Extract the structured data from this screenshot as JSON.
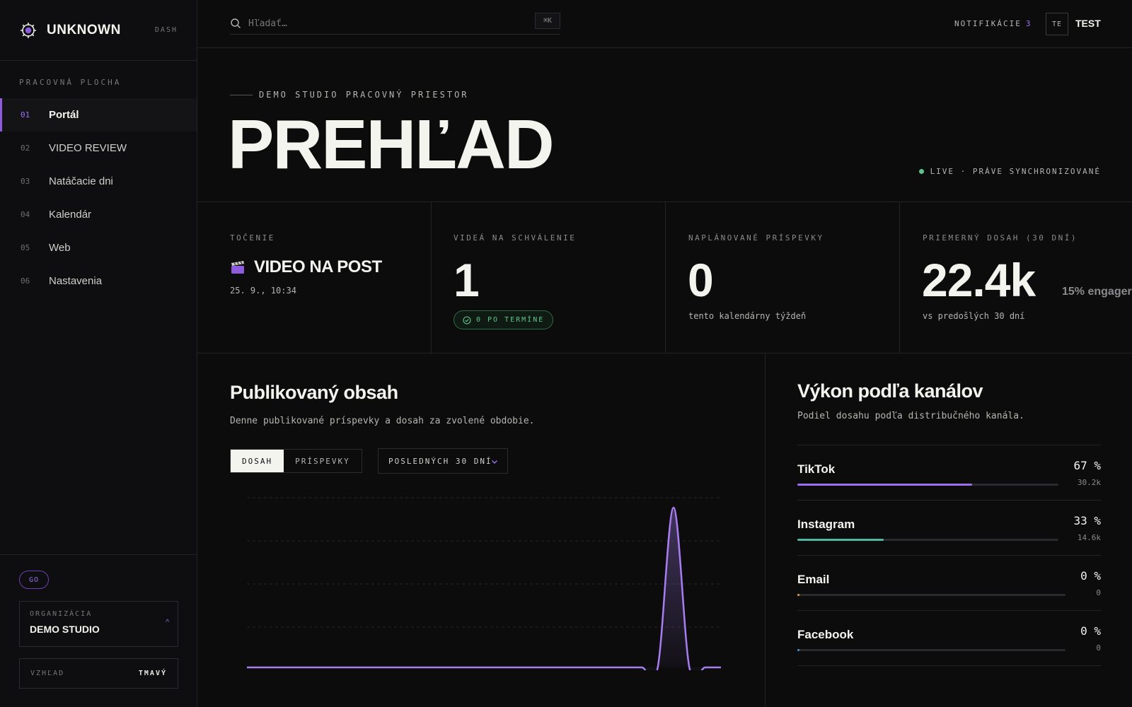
{
  "brand": {
    "name": "UNKNOWN",
    "tag": "DASH"
  },
  "sidebar": {
    "section_label": "PRACOVNÁ PLOCHA",
    "items": [
      {
        "num": "01",
        "label": "Portál",
        "active": true
      },
      {
        "num": "02",
        "label": "VIDEO REVIEW"
      },
      {
        "num": "03",
        "label": "Natáčacie dni"
      },
      {
        "num": "04",
        "label": "Kalendár"
      },
      {
        "num": "05",
        "label": "Web"
      },
      {
        "num": "06",
        "label": "Nastavenia"
      }
    ],
    "badge": "GO",
    "org": {
      "label": "ORGANIZÁCIA",
      "name": "DEMO STUDIO",
      "caret": "^"
    },
    "appearance": {
      "label": "VZHĽAD",
      "value": "TMAVÝ"
    }
  },
  "topbar": {
    "search_placeholder": "Hľadať…",
    "shortcut": "⌘K",
    "notifications_label": "NOTIFIKÁCIE",
    "notifications_count": "3",
    "avatar_initials": "TE",
    "user_name": "TEST"
  },
  "header": {
    "eyebrow": "DEMO STUDIO PRACOVNÝ PRIESTOR",
    "title": "PREHĽAD",
    "live_status": "LIVE · PRÁVE SYNCHRONIZOVANÉ"
  },
  "stats": {
    "shooting": {
      "label": "TOČENIE",
      "title": "VIDEO NA POST",
      "date": "25. 9., 10:34"
    },
    "approval": {
      "label": "VIDEÁ NA SCHVÁLENIE",
      "value": "1",
      "badge": "0 PO TERMÍNE"
    },
    "scheduled": {
      "label": "NAPLÁNOVANÉ PRÍSPEVKY",
      "value": "0",
      "sub": "tento kalendárny týždeň"
    },
    "reach": {
      "label": "PRIEMERNÝ DOSAH (30 DNÍ)",
      "value": "22.4k",
      "engagement": "15% engager",
      "sub": "vs predošlých 30 dní"
    }
  },
  "published": {
    "title": "Publikovaný obsah",
    "subtitle": "Denne publikované príspevky a dosah za zvolené obdobie.",
    "tabs": [
      {
        "label": "DOSAH",
        "active": true
      },
      {
        "label": "PRÍSPEVKY"
      }
    ],
    "period": "POSLEDNÝCH 30 DNÍ"
  },
  "channels": {
    "title": "Výkon podľa kanálov",
    "subtitle": "Podiel dosahu podľa distribučného kanála.",
    "items": [
      {
        "name": "TikTok",
        "pct": "67 %",
        "count": "30.2k",
        "share": 0.67,
        "color": "#9b6ff0"
      },
      {
        "name": "Instagram",
        "pct": "33 %",
        "count": "14.6k",
        "share": 0.33,
        "color": "#4fb7a0"
      },
      {
        "name": "Email",
        "pct": "0 %",
        "count": "0",
        "share": 0,
        "color": "#e0a14a"
      },
      {
        "name": "Facebook",
        "pct": "0 %",
        "count": "0",
        "share": 0,
        "color": "#4a8ee0"
      }
    ]
  },
  "chart_data": {
    "type": "area",
    "series": [
      {
        "values": [
          0,
          0,
          0,
          0,
          0,
          0,
          0,
          0,
          0,
          0,
          0,
          0,
          0,
          0,
          0,
          0,
          0,
          0,
          0,
          0,
          0,
          0,
          0,
          0,
          0,
          0,
          0,
          1,
          0,
          0,
          0
        ]
      }
    ],
    "color": "#a77ef0",
    "grid": true
  }
}
